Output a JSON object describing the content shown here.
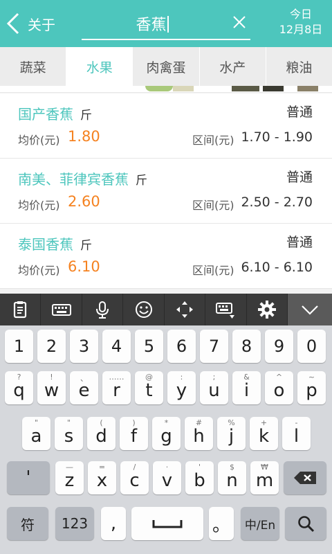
{
  "header": {
    "back_label": "关于",
    "search_value": "香蕉",
    "date_line1": "今日",
    "date_line2": "12月8日"
  },
  "tabs": [
    {
      "label": "蔬菜",
      "active": false
    },
    {
      "label": "水果",
      "active": true
    },
    {
      "label": "肉禽蛋",
      "active": false
    },
    {
      "label": "水产",
      "active": false
    },
    {
      "label": "粮油",
      "active": false
    }
  ],
  "items": [
    {
      "name": "国产香蕉",
      "unit": "斤",
      "grade": "普通",
      "avg_label": "均价(元)",
      "avg": "1.80",
      "range_label": "区间(元)",
      "range": "1.70 - 1.90"
    },
    {
      "name": "南美、菲律宾香蕉",
      "unit": "斤",
      "grade": "普通",
      "avg_label": "均价(元)",
      "avg": "2.60",
      "range_label": "区间(元)",
      "range": "2.50 - 2.70"
    },
    {
      "name": "泰国香蕉",
      "unit": "斤",
      "grade": "普通",
      "avg_label": "均价(元)",
      "avg": "6.10",
      "range_label": "区间(元)",
      "range": "6.10 - 6.10"
    }
  ],
  "toolbar_icons": [
    "clipboard-icon",
    "keyboard-icon",
    "microphone-icon",
    "emoji-icon",
    "cursor-move-icon",
    "keyboard-layout-icon",
    "gear-icon",
    "chevron-down-icon"
  ],
  "keyboard": {
    "numbers": [
      "1",
      "2",
      "3",
      "4",
      "5",
      "6",
      "7",
      "8",
      "9",
      "0"
    ],
    "row1": [
      {
        "k": "q",
        "s": "?"
      },
      {
        "k": "w",
        "s": "!"
      },
      {
        "k": "e",
        "s": "、"
      },
      {
        "k": "r",
        "s": "……"
      },
      {
        "k": "t",
        "s": "@"
      },
      {
        "k": "y",
        "s": ":"
      },
      {
        "k": "u",
        "s": ";"
      },
      {
        "k": "i",
        "s": "&"
      },
      {
        "k": "o",
        "s": "^"
      },
      {
        "k": "p",
        "s": "~"
      }
    ],
    "row2": [
      {
        "k": "a",
        "s": "\""
      },
      {
        "k": "s",
        "s": "\""
      },
      {
        "k": "d",
        "s": "("
      },
      {
        "k": "f",
        "s": ")"
      },
      {
        "k": "g",
        "s": "*"
      },
      {
        "k": "h",
        "s": "#"
      },
      {
        "k": "j",
        "s": "%"
      },
      {
        "k": "k",
        "s": "+"
      },
      {
        "k": "l",
        "s": "-"
      }
    ],
    "row3_lead": "'",
    "row3": [
      {
        "k": "z",
        "s": "—"
      },
      {
        "k": "x",
        "s": "="
      },
      {
        "k": "c",
        "s": "/"
      },
      {
        "k": "v",
        "s": "·"
      },
      {
        "k": "b",
        "s": "'"
      },
      {
        "k": "n",
        "s": "$"
      },
      {
        "k": "m",
        "s": "₩"
      }
    ],
    "symbol_label": "符",
    "num_label": "123",
    "comma": ",",
    "space": "␣",
    "period": "。",
    "lang_label": "中/En"
  },
  "colors": {
    "accent": "#4dc6bd",
    "price": "#f58220"
  }
}
